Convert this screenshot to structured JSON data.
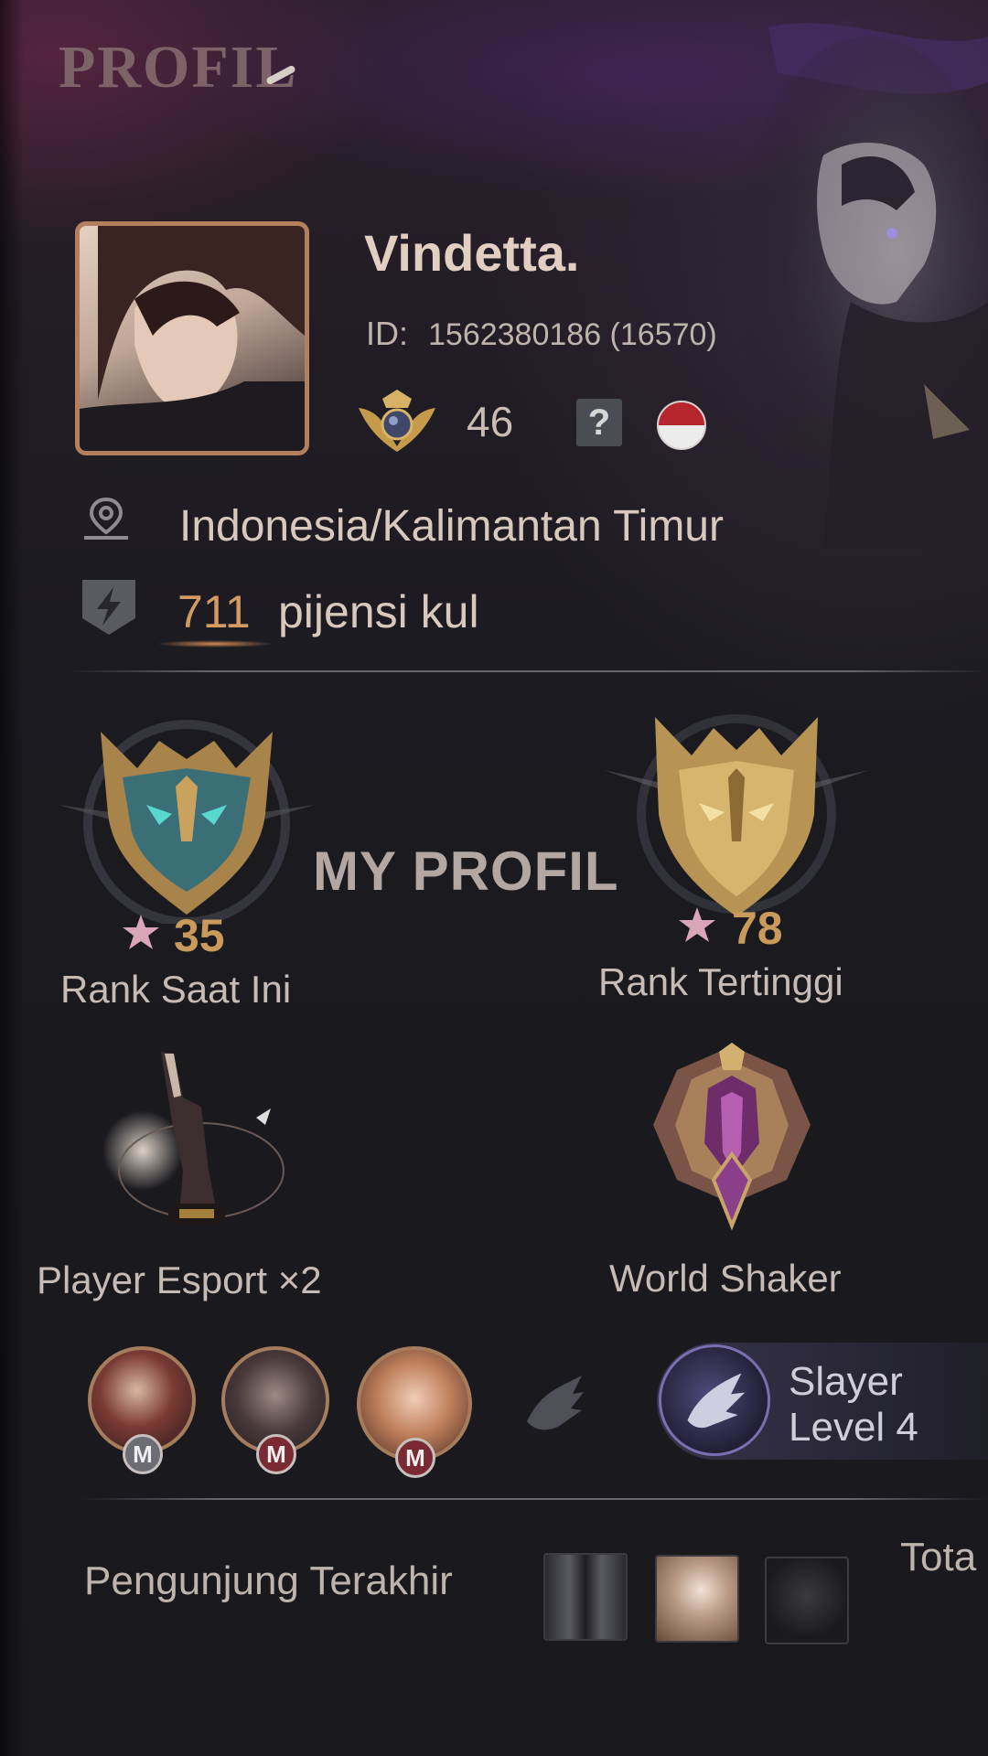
{
  "header": {
    "title": "PROFIL"
  },
  "profile": {
    "name": "Vindetta.",
    "id_label": "ID:",
    "id_value": "1562380186 (16570)",
    "level": "46",
    "help_symbol": "?",
    "location": "Indonesia/Kalimantan Timur",
    "popularity_value": "711",
    "popularity_label": "pijensi kul"
  },
  "watermark": "MY PROFIL",
  "ranks": {
    "current": {
      "stars": "35",
      "label": "Rank Saat Ini"
    },
    "highest": {
      "stars": "78",
      "label": "Rank Tertinggi"
    }
  },
  "achievements": {
    "esport": {
      "label": "Player Esport ×2"
    },
    "world": {
      "label": "World Shaker"
    }
  },
  "heroes": {
    "badge_letter": "M"
  },
  "slayer": {
    "line1": "Slayer",
    "line2": "Level 4"
  },
  "visitors": {
    "label": "Pengunjung Terakhir",
    "total_label": "Tota"
  },
  "colors": {
    "accent": "#b37f5c",
    "popularity": "#d39a62",
    "background": "#1a1a1f"
  }
}
